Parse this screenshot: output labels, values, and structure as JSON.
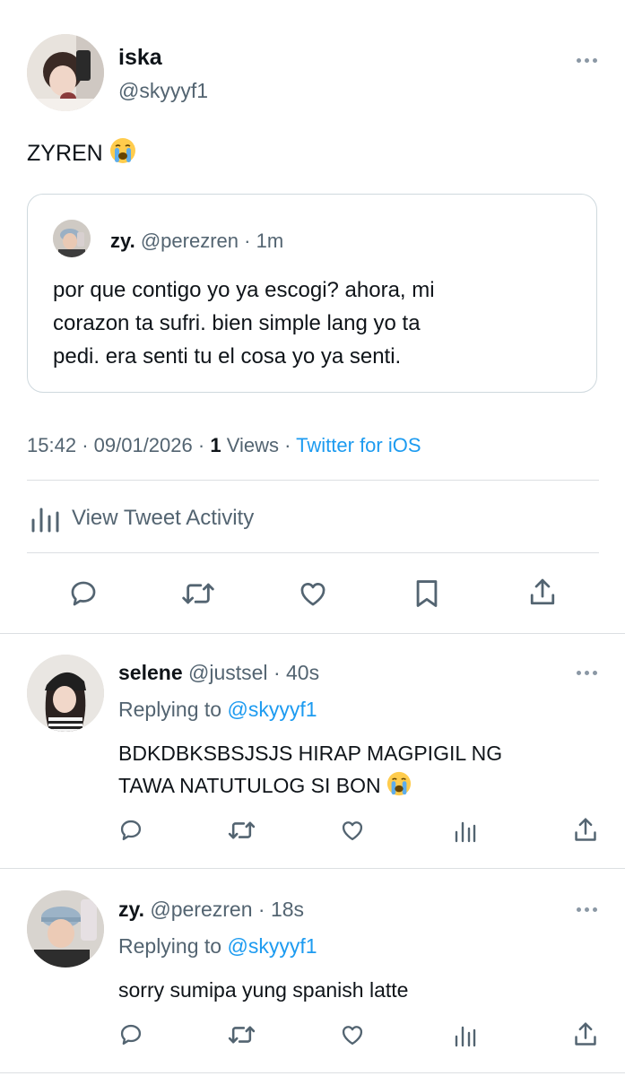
{
  "main_tweet": {
    "display_name": "iska",
    "handle": "@skyyyf1",
    "text": "ZYREN",
    "quoted": {
      "display_name": "zy.",
      "handle": "@perezren",
      "time": "· 1m",
      "lines": [
        "por que contigo yo ya escogi? ahora, mi",
        "corazon ta sufri. bien simple lang yo ta",
        "pedi. era senti tu el cosa yo ya senti."
      ]
    },
    "meta": {
      "time": "15:42",
      "date_sep": "·",
      "date": "09/01/2026",
      "views_sep": "·",
      "views_count": "1",
      "views_label": "Views",
      "source_sep": "·",
      "source": "Twitter for iOS"
    },
    "activity_label": "View Tweet Activity"
  },
  "replies": [
    {
      "display_name": "selene",
      "handle": "@justsel",
      "time": "· 40s",
      "replying_prefix": "Replying to",
      "replying_handle": "@skyyyf1",
      "lines": [
        "BDKDBKSBSJSJS HIRAP MAGPIGIL NG",
        "TAWA NATUTULOG SI BON"
      ]
    },
    {
      "display_name": "zy.",
      "handle": "@perezren",
      "time": "· 18s",
      "replying_prefix": "Replying to",
      "replying_handle": "@skyyyf1",
      "lines": [
        "sorry sumipa yung spanish latte"
      ]
    }
  ],
  "colors": {
    "text": "#0f1419",
    "secondary": "#536471",
    "link": "#1d9bf0",
    "divider": "#dcdfe2"
  },
  "icons": [
    "more-icon",
    "loudly-crying-emoji",
    "reply-icon",
    "retweet-icon",
    "like-icon",
    "bookmark-icon",
    "share-icon",
    "analytics-icon"
  ]
}
